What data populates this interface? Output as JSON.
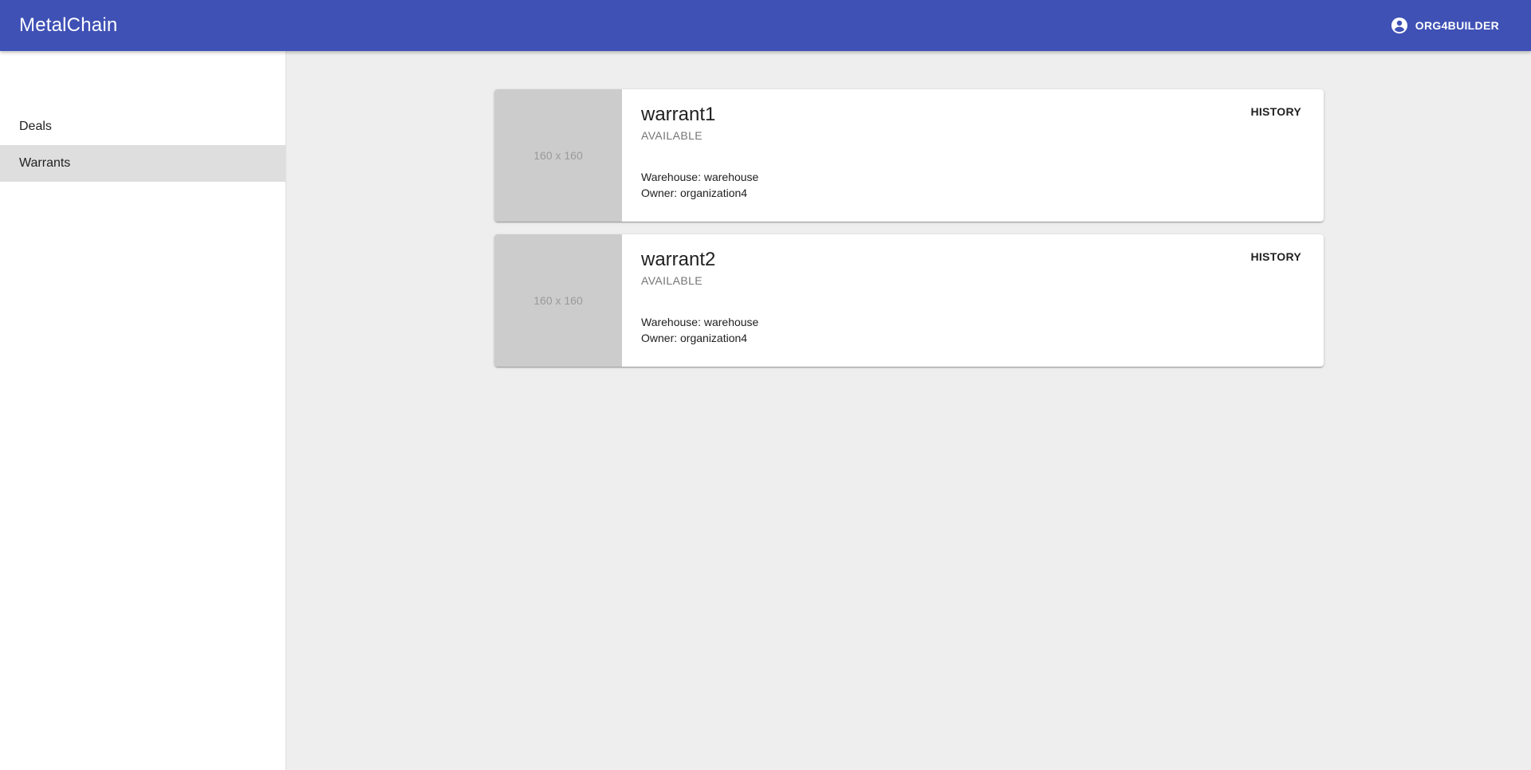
{
  "app": {
    "title": "MetalChain",
    "header_color": "#3f51b5",
    "user": {
      "icon": "account-circle-icon",
      "label": "ORG4BUILDER"
    }
  },
  "sidebar": {
    "items": [
      {
        "label": "Deals",
        "selected": false
      },
      {
        "label": "Warrants",
        "selected": true
      }
    ]
  },
  "warrants": [
    {
      "image_placeholder": "160 x 160",
      "title": "warrant1",
      "status": "AVAILABLE",
      "warehouse": "Warehouse: warehouse",
      "owner": "Owner: organization4",
      "action": "HISTORY"
    },
    {
      "image_placeholder": "160 x 160",
      "title": "warrant2",
      "status": "AVAILABLE",
      "warehouse": "Warehouse: warehouse",
      "owner": "Owner: organization4",
      "action": "HISTORY"
    }
  ]
}
